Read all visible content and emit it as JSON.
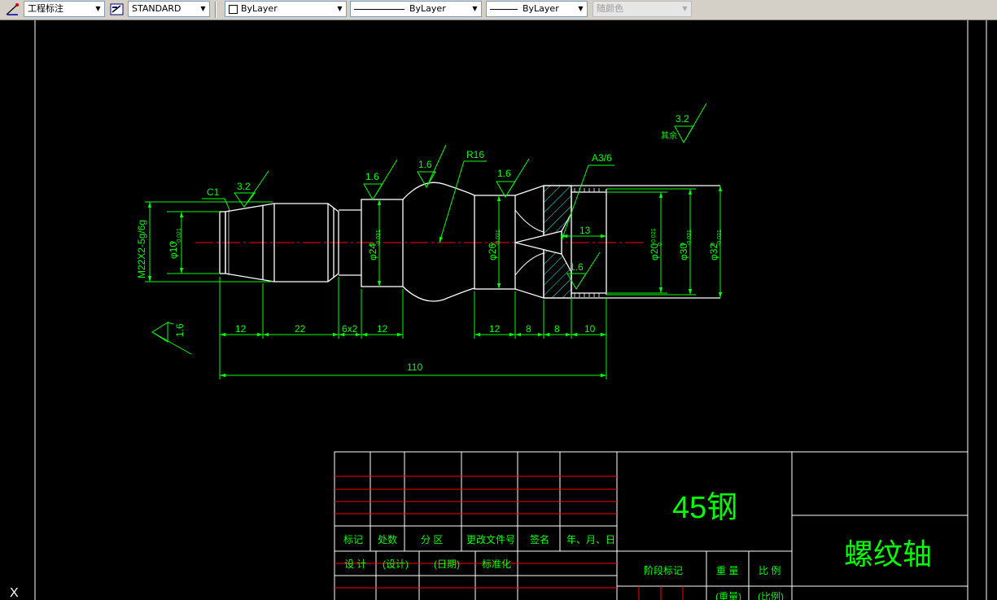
{
  "toolbar": {
    "dimstyle": "工程标注",
    "textstyle": "STANDARD",
    "layer": "ByLayer",
    "linetype": "ByLayer",
    "lineweight": "ByLayer",
    "color": "随颜色"
  },
  "drawing": {
    "surface_top": "3.2",
    "surface_top_label": "其余",
    "chamfer": "C1",
    "thread": "M22X2-5g/6g",
    "radius": "R16",
    "center_hole": "A3/6",
    "roughness_c1": "3.2",
    "roughness_a": "1.6",
    "roughness_b": "1.6",
    "roughness_c": "1.6",
    "roughness_d": "1.6",
    "roughness_left": "1.6",
    "dia_10": "φ10",
    "dia_10_tol": "0\n-0.021",
    "dia_24": "φ24",
    "dia_24_tol": "0\n-0.021",
    "dia_26": "φ26",
    "dia_26_tol": "0\n-0.021",
    "dia_20": "φ20",
    "dia_20_tol": "+0.021\n0",
    "dia_30": "φ30",
    "dia_30_tol": "0\n-0.021",
    "dia_32": "φ32",
    "dia_32_tol": "0\n-0.021",
    "dim_13": "13",
    "dims": [
      "12",
      "22",
      "6x2",
      "12",
      "12",
      "8",
      "8",
      "10"
    ],
    "dim_total": "110"
  },
  "title_block": {
    "material": "45钢",
    "part_name": "螺纹轴",
    "row_headers": [
      "标记",
      "处数",
      "分 区",
      "更改文件号",
      "签名",
      "年、月、日"
    ],
    "design": "设 计",
    "design_p": "(设计)",
    "date_p": "(日期)",
    "standardize": "标准化",
    "stage_mark": "阶段标记",
    "weight": "重 量",
    "scale": "比 例",
    "weight_p": "(重量)",
    "scale_p": "(比例)"
  },
  "ucs": {
    "axis_x": "X"
  },
  "colors": {
    "line": "#ffffff",
    "dim": "#00ff00",
    "center": "#ff0000",
    "hatch": "#00ffff",
    "frame": "#ffffff"
  }
}
